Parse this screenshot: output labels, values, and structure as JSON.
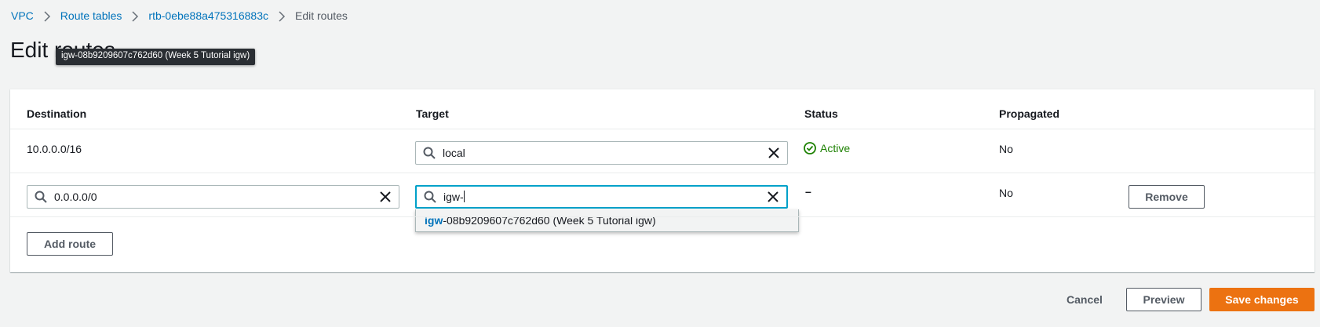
{
  "breadcrumb": {
    "items": [
      "VPC",
      "Route tables",
      "rtb-0ebe88a475316883c"
    ],
    "current": "Edit routes"
  },
  "page": {
    "title": "Edit routes"
  },
  "tooltip": {
    "text": "igw-08b9209607c762d60 (Week 5 Tutorial igw)"
  },
  "table": {
    "headers": {
      "destination": "Destination",
      "target": "Target",
      "status": "Status",
      "propagated": "Propagated"
    },
    "rows": [
      {
        "destination": "10.0.0.0/16",
        "target": "local",
        "status": "Active",
        "propagated": "No"
      },
      {
        "destination": "0.0.0.0/0",
        "target": "igw-",
        "status": "–",
        "propagated": "No",
        "remove_label": "Remove"
      }
    ],
    "suggestion": {
      "match": "igw",
      "rest": "-08b9209607c762d60 (Week 5 Tutorial igw)"
    },
    "add_route_label": "Add route"
  },
  "footer": {
    "cancel_label": "Cancel",
    "preview_label": "Preview",
    "save_label": "Save changes"
  },
  "colors": {
    "link": "#0073bb",
    "active_status": "#1d8102",
    "primary_button": "#ec7211",
    "focus_border": "#00a1c9"
  }
}
